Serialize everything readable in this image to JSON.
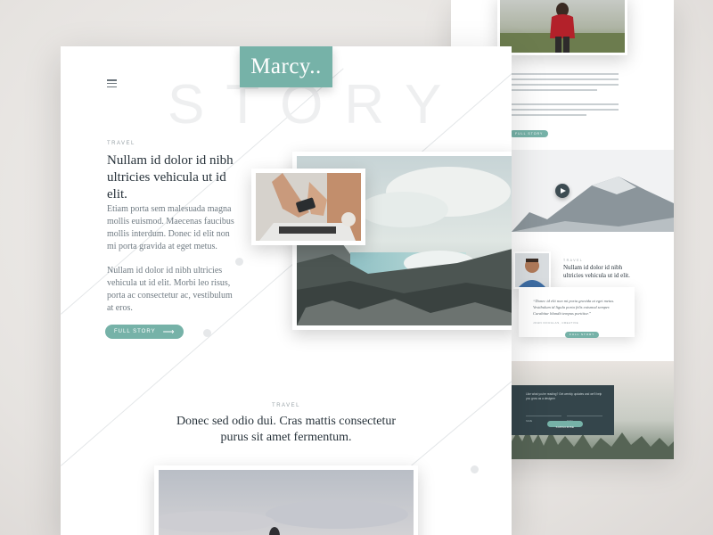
{
  "front": {
    "logo": "Marcy..",
    "watermark": "STORY",
    "hero": {
      "kicker": "TRAVEL",
      "title": "Nullam id dolor id nibh ultricies vehicula ut id elit.",
      "paragraph1": "Etiam porta sem malesuada magna mollis euismod. Maecenas faucibus mollis interdum. Donec id elit non mi porta gravida at eget metus.",
      "paragraph2": "Nullam id dolor id nibh ultricies vehicula ut id elit. Morbi leo risus, porta ac consectetur ac, vestibulum at eros.",
      "button_label": "FULL STORY",
      "button_arrow": "⟶"
    },
    "section2": {
      "kicker": "TRAVEL",
      "title": "Donec sed odio dui. Cras mattis consectetur purus sit amet fermentum."
    }
  },
  "back": {
    "text1": "...",
    "text2": "...",
    "button_label": "FULL STORY",
    "profile": {
      "kicker": "TRAVEL",
      "title": "Nullam id dolor id nibh ultricies vehicula ut id elit."
    },
    "quote": {
      "text": "“Donec id elit non mi porta gravida at eget metus. Vestibulum id ligula porta felis euismod semper. Curabitur blandit tempus porttitor.”",
      "author": "JOHN DOUGLAS, CREATIVE",
      "button_label": "FULL STORY"
    },
    "newsletter": {
      "text": "Like what you're reading? Get weekly updates and we'll help you grow as a designer",
      "field1": "NAME",
      "field2": "EMAIL",
      "button_label": "SUBSCRIBE"
    }
  },
  "colors": {
    "accent": "#76b2a8",
    "dark_panel": "#34454b"
  }
}
